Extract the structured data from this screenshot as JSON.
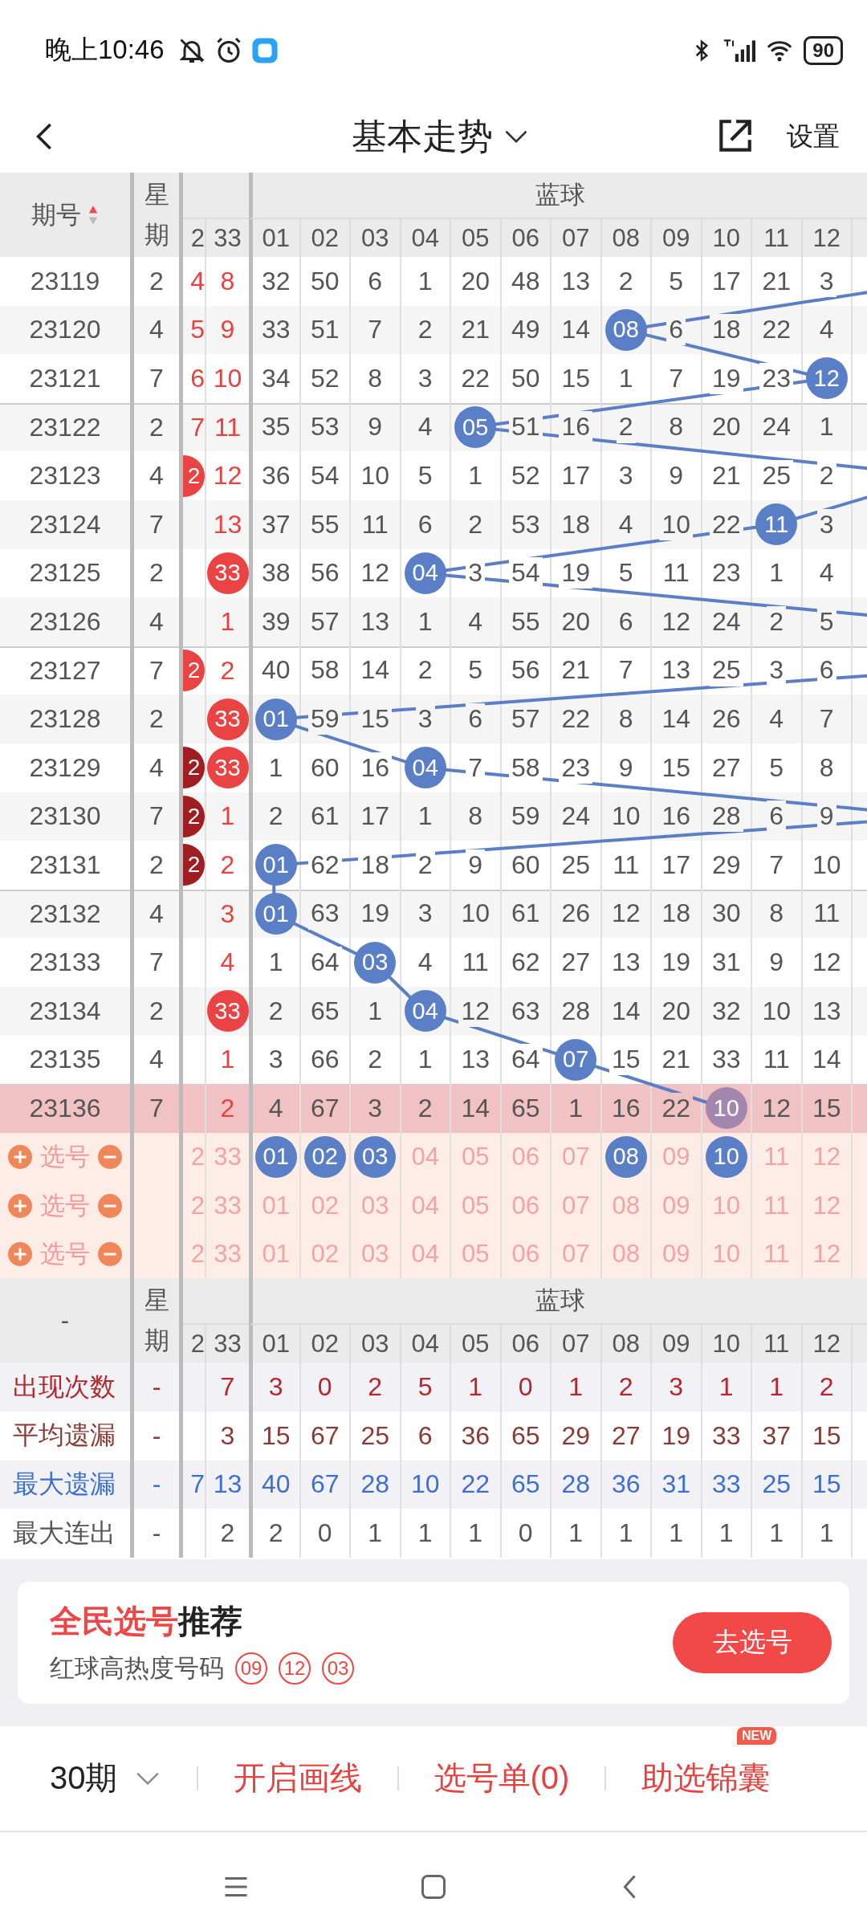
{
  "status_bar": {
    "time": "晚上10:46",
    "battery": "90"
  },
  "header": {
    "title": "基本走势",
    "settings": "设置"
  },
  "table_header": {
    "issue": "期号",
    "weekday": "星期",
    "group": "蓝球",
    "cut_column": "2",
    "red_column": "33",
    "columns": [
      "01",
      "02",
      "03",
      "04",
      "05",
      "06",
      "07",
      "08",
      "09",
      "10",
      "11",
      "12"
    ]
  },
  "rows": [
    {
      "issue": "23119",
      "weekday": "2",
      "cut": {
        "text": "4",
        "kind": "plain"
      },
      "red": {
        "text": "8",
        "ball": false
      },
      "blue": [
        {
          "text": "32",
          "ball": false
        },
        {
          "text": "50",
          "ball": false
        },
        {
          "text": "6",
          "ball": false
        },
        {
          "text": "1",
          "ball": false
        },
        {
          "text": "20",
          "ball": false
        },
        {
          "text": "48",
          "ball": false
        },
        {
          "text": "13",
          "ball": false
        },
        {
          "text": "2",
          "ball": false
        },
        {
          "text": "5",
          "ball": false
        },
        {
          "text": "17",
          "ball": false
        },
        {
          "text": "21",
          "ball": false
        },
        {
          "text": "3",
          "ball": false
        }
      ],
      "highlighted": false
    },
    {
      "issue": "23120",
      "weekday": "4",
      "cut": {
        "text": "5",
        "kind": "plain"
      },
      "red": {
        "text": "9",
        "ball": false
      },
      "blue": [
        {
          "text": "33",
          "ball": false
        },
        {
          "text": "51",
          "ball": false
        },
        {
          "text": "7",
          "ball": false
        },
        {
          "text": "2",
          "ball": false
        },
        {
          "text": "21",
          "ball": false
        },
        {
          "text": "49",
          "ball": false
        },
        {
          "text": "14",
          "ball": false
        },
        {
          "text": "08",
          "ball": true
        },
        {
          "text": "6",
          "ball": false
        },
        {
          "text": "18",
          "ball": false
        },
        {
          "text": "22",
          "ball": false
        },
        {
          "text": "4",
          "ball": false
        }
      ],
      "highlighted": false
    },
    {
      "issue": "23121",
      "weekday": "7",
      "cut": {
        "text": "6",
        "kind": "plain"
      },
      "red": {
        "text": "10",
        "ball": false
      },
      "blue": [
        {
          "text": "34",
          "ball": false
        },
        {
          "text": "52",
          "ball": false
        },
        {
          "text": "8",
          "ball": false
        },
        {
          "text": "3",
          "ball": false
        },
        {
          "text": "22",
          "ball": false
        },
        {
          "text": "50",
          "ball": false
        },
        {
          "text": "15",
          "ball": false
        },
        {
          "text": "1",
          "ball": false
        },
        {
          "text": "7",
          "ball": false
        },
        {
          "text": "19",
          "ball": false
        },
        {
          "text": "23",
          "ball": false
        },
        {
          "text": "12",
          "ball": true
        }
      ],
      "highlighted": false
    },
    {
      "issue": "23122",
      "weekday": "2",
      "cut": {
        "text": "7",
        "kind": "plain"
      },
      "red": {
        "text": "11",
        "ball": false
      },
      "blue": [
        {
          "text": "35",
          "ball": false
        },
        {
          "text": "53",
          "ball": false
        },
        {
          "text": "9",
          "ball": false
        },
        {
          "text": "4",
          "ball": false
        },
        {
          "text": "05",
          "ball": true
        },
        {
          "text": "51",
          "ball": false
        },
        {
          "text": "16",
          "ball": false
        },
        {
          "text": "2",
          "ball": false
        },
        {
          "text": "8",
          "ball": false
        },
        {
          "text": "20",
          "ball": false
        },
        {
          "text": "24",
          "ball": false
        },
        {
          "text": "1",
          "ball": false
        }
      ],
      "highlighted": false
    },
    {
      "issue": "23123",
      "weekday": "4",
      "cut": {
        "text": "2",
        "kind": "ball"
      },
      "red": {
        "text": "12",
        "ball": false
      },
      "blue": [
        {
          "text": "36",
          "ball": false
        },
        {
          "text": "54",
          "ball": false
        },
        {
          "text": "10",
          "ball": false
        },
        {
          "text": "5",
          "ball": false
        },
        {
          "text": "1",
          "ball": false
        },
        {
          "text": "52",
          "ball": false
        },
        {
          "text": "17",
          "ball": false
        },
        {
          "text": "3",
          "ball": false
        },
        {
          "text": "9",
          "ball": false
        },
        {
          "text": "21",
          "ball": false
        },
        {
          "text": "25",
          "ball": false
        },
        {
          "text": "2",
          "ball": false
        }
      ],
      "highlighted": false
    },
    {
      "issue": "23124",
      "weekday": "7",
      "red": {
        "text": "13",
        "ball": false
      },
      "blue": [
        {
          "text": "37",
          "ball": false
        },
        {
          "text": "55",
          "ball": false
        },
        {
          "text": "11",
          "ball": false
        },
        {
          "text": "6",
          "ball": false
        },
        {
          "text": "2",
          "ball": false
        },
        {
          "text": "53",
          "ball": false
        },
        {
          "text": "18",
          "ball": false
        },
        {
          "text": "4",
          "ball": false
        },
        {
          "text": "10",
          "ball": false
        },
        {
          "text": "22",
          "ball": false
        },
        {
          "text": "11",
          "ball": true
        },
        {
          "text": "3",
          "ball": false
        }
      ],
      "highlighted": false
    },
    {
      "issue": "23125",
      "weekday": "2",
      "red": {
        "text": "33",
        "ball": true
      },
      "blue": [
        {
          "text": "38",
          "ball": false
        },
        {
          "text": "56",
          "ball": false
        },
        {
          "text": "12",
          "ball": false
        },
        {
          "text": "04",
          "ball": true
        },
        {
          "text": "3",
          "ball": false
        },
        {
          "text": "54",
          "ball": false
        },
        {
          "text": "19",
          "ball": false
        },
        {
          "text": "5",
          "ball": false
        },
        {
          "text": "11",
          "ball": false
        },
        {
          "text": "23",
          "ball": false
        },
        {
          "text": "1",
          "ball": false
        },
        {
          "text": "4",
          "ball": false
        }
      ],
      "highlighted": false
    },
    {
      "issue": "23126",
      "weekday": "4",
      "red": {
        "text": "1",
        "ball": false
      },
      "blue": [
        {
          "text": "39",
          "ball": false
        },
        {
          "text": "57",
          "ball": false
        },
        {
          "text": "13",
          "ball": false
        },
        {
          "text": "1",
          "ball": false
        },
        {
          "text": "4",
          "ball": false
        },
        {
          "text": "55",
          "ball": false
        },
        {
          "text": "20",
          "ball": false
        },
        {
          "text": "6",
          "ball": false
        },
        {
          "text": "12",
          "ball": false
        },
        {
          "text": "24",
          "ball": false
        },
        {
          "text": "2",
          "ball": false
        },
        {
          "text": "5",
          "ball": false
        }
      ],
      "highlighted": false
    },
    {
      "issue": "23127",
      "weekday": "7",
      "cut": {
        "text": "2",
        "kind": "ball"
      },
      "red": {
        "text": "2",
        "ball": false
      },
      "blue": [
        {
          "text": "40",
          "ball": false
        },
        {
          "text": "58",
          "ball": false
        },
        {
          "text": "14",
          "ball": false
        },
        {
          "text": "2",
          "ball": false
        },
        {
          "text": "5",
          "ball": false
        },
        {
          "text": "56",
          "ball": false
        },
        {
          "text": "21",
          "ball": false
        },
        {
          "text": "7",
          "ball": false
        },
        {
          "text": "13",
          "ball": false
        },
        {
          "text": "25",
          "ball": false
        },
        {
          "text": "3",
          "ball": false
        },
        {
          "text": "6",
          "ball": false
        }
      ],
      "highlighted": false
    },
    {
      "issue": "23128",
      "weekday": "2",
      "red": {
        "text": "33",
        "ball": true
      },
      "blue": [
        {
          "text": "01",
          "ball": true
        },
        {
          "text": "59",
          "ball": false
        },
        {
          "text": "15",
          "ball": false
        },
        {
          "text": "3",
          "ball": false
        },
        {
          "text": "6",
          "ball": false
        },
        {
          "text": "57",
          "ball": false
        },
        {
          "text": "22",
          "ball": false
        },
        {
          "text": "8",
          "ball": false
        },
        {
          "text": "14",
          "ball": false
        },
        {
          "text": "26",
          "ball": false
        },
        {
          "text": "4",
          "ball": false
        },
        {
          "text": "7",
          "ball": false
        }
      ],
      "highlighted": false
    },
    {
      "issue": "23129",
      "weekday": "4",
      "cut": {
        "text": "2",
        "kind": "dark_ball"
      },
      "red": {
        "text": "33",
        "ball": true
      },
      "blue": [
        {
          "text": "1",
          "ball": false
        },
        {
          "text": "60",
          "ball": false
        },
        {
          "text": "16",
          "ball": false
        },
        {
          "text": "04",
          "ball": true
        },
        {
          "text": "7",
          "ball": false
        },
        {
          "text": "58",
          "ball": false
        },
        {
          "text": "23",
          "ball": false
        },
        {
          "text": "9",
          "ball": false
        },
        {
          "text": "15",
          "ball": false
        },
        {
          "text": "27",
          "ball": false
        },
        {
          "text": "5",
          "ball": false
        },
        {
          "text": "8",
          "ball": false
        }
      ],
      "highlighted": false
    },
    {
      "issue": "23130",
      "weekday": "7",
      "cut": {
        "text": "2",
        "kind": "dark_ball"
      },
      "red": {
        "text": "1",
        "ball": false
      },
      "blue": [
        {
          "text": "2",
          "ball": false
        },
        {
          "text": "61",
          "ball": false
        },
        {
          "text": "17",
          "ball": false
        },
        {
          "text": "1",
          "ball": false
        },
        {
          "text": "8",
          "ball": false
        },
        {
          "text": "59",
          "ball": false
        },
        {
          "text": "24",
          "ball": false
        },
        {
          "text": "10",
          "ball": false
        },
        {
          "text": "16",
          "ball": false
        },
        {
          "text": "28",
          "ball": false
        },
        {
          "text": "6",
          "ball": false
        },
        {
          "text": "9",
          "ball": false
        }
      ],
      "highlighted": false
    },
    {
      "issue": "23131",
      "weekday": "2",
      "cut": {
        "text": "2",
        "kind": "dark_ball"
      },
      "red": {
        "text": "2",
        "ball": false
      },
      "blue": [
        {
          "text": "01",
          "ball": true
        },
        {
          "text": "62",
          "ball": false
        },
        {
          "text": "18",
          "ball": false
        },
        {
          "text": "2",
          "ball": false
        },
        {
          "text": "9",
          "ball": false
        },
        {
          "text": "60",
          "ball": false
        },
        {
          "text": "25",
          "ball": false
        },
        {
          "text": "11",
          "ball": false
        },
        {
          "text": "17",
          "ball": false
        },
        {
          "text": "29",
          "ball": false
        },
        {
          "text": "7",
          "ball": false
        },
        {
          "text": "10",
          "ball": false
        }
      ],
      "highlighted": false
    },
    {
      "issue": "23132",
      "weekday": "4",
      "red": {
        "text": "3",
        "ball": false
      },
      "blue": [
        {
          "text": "01",
          "ball": true
        },
        {
          "text": "63",
          "ball": false
        },
        {
          "text": "19",
          "ball": false
        },
        {
          "text": "3",
          "ball": false
        },
        {
          "text": "10",
          "ball": false
        },
        {
          "text": "61",
          "ball": false
        },
        {
          "text": "26",
          "ball": false
        },
        {
          "text": "12",
          "ball": false
        },
        {
          "text": "18",
          "ball": false
        },
        {
          "text": "30",
          "ball": false
        },
        {
          "text": "8",
          "ball": false
        },
        {
          "text": "11",
          "ball": false
        }
      ],
      "highlighted": false
    },
    {
      "issue": "23133",
      "weekday": "7",
      "red": {
        "text": "4",
        "ball": false
      },
      "blue": [
        {
          "text": "1",
          "ball": false
        },
        {
          "text": "64",
          "ball": false
        },
        {
          "text": "03",
          "ball": true
        },
        {
          "text": "4",
          "ball": false
        },
        {
          "text": "11",
          "ball": false
        },
        {
          "text": "62",
          "ball": false
        },
        {
          "text": "27",
          "ball": false
        },
        {
          "text": "13",
          "ball": false
        },
        {
          "text": "19",
          "ball": false
        },
        {
          "text": "31",
          "ball": false
        },
        {
          "text": "9",
          "ball": false
        },
        {
          "text": "12",
          "ball": false
        }
      ],
      "highlighted": false
    },
    {
      "issue": "23134",
      "weekday": "2",
      "red": {
        "text": "33",
        "ball": true
      },
      "blue": [
        {
          "text": "2",
          "ball": false
        },
        {
          "text": "65",
          "ball": false
        },
        {
          "text": "1",
          "ball": false
        },
        {
          "text": "04",
          "ball": true
        },
        {
          "text": "12",
          "ball": false
        },
        {
          "text": "63",
          "ball": false
        },
        {
          "text": "28",
          "ball": false
        },
        {
          "text": "14",
          "ball": false
        },
        {
          "text": "20",
          "ball": false
        },
        {
          "text": "32",
          "ball": false
        },
        {
          "text": "10",
          "ball": false
        },
        {
          "text": "13",
          "ball": false
        }
      ],
      "highlighted": false
    },
    {
      "issue": "23135",
      "weekday": "4",
      "red": {
        "text": "1",
        "ball": false
      },
      "blue": [
        {
          "text": "3",
          "ball": false
        },
        {
          "text": "66",
          "ball": false
        },
        {
          "text": "2",
          "ball": false
        },
        {
          "text": "1",
          "ball": false
        },
        {
          "text": "13",
          "ball": false
        },
        {
          "text": "64",
          "ball": false
        },
        {
          "text": "07",
          "ball": true
        },
        {
          "text": "15",
          "ball": false
        },
        {
          "text": "21",
          "ball": false
        },
        {
          "text": "33",
          "ball": false
        },
        {
          "text": "11",
          "ball": false
        },
        {
          "text": "14",
          "ball": false
        }
      ],
      "highlighted": false
    },
    {
      "issue": "23136",
      "weekday": "7",
      "red": {
        "text": "2",
        "ball": false
      },
      "blue": [
        {
          "text": "4",
          "ball": false
        },
        {
          "text": "67",
          "ball": false
        },
        {
          "text": "3",
          "ball": false
        },
        {
          "text": "2",
          "ball": false
        },
        {
          "text": "14",
          "ball": false
        },
        {
          "text": "65",
          "ball": false
        },
        {
          "text": "1",
          "ball": false
        },
        {
          "text": "16",
          "ball": false
        },
        {
          "text": "22",
          "ball": false
        },
        {
          "text": "10",
          "ball": true
        },
        {
          "text": "12",
          "ball": false
        },
        {
          "text": "15",
          "ball": false
        }
      ],
      "highlighted": true
    }
  ],
  "pick_rows": [
    {
      "label": "选号",
      "cut": "2",
      "red": "33",
      "blue": [
        {
          "text": "01",
          "selected": true
        },
        {
          "text": "02",
          "selected": true
        },
        {
          "text": "03",
          "selected": true
        },
        {
          "text": "04",
          "selected": false
        },
        {
          "text": "05",
          "selected": false
        },
        {
          "text": "06",
          "selected": false
        },
        {
          "text": "07",
          "selected": false
        },
        {
          "text": "08",
          "selected": true
        },
        {
          "text": "09",
          "selected": false
        },
        {
          "text": "10",
          "selected": true
        },
        {
          "text": "11",
          "selected": false
        },
        {
          "text": "12",
          "selected": false
        }
      ]
    },
    {
      "label": "选号",
      "cut": "2",
      "red": "33",
      "blue": [
        {
          "text": "01",
          "selected": false
        },
        {
          "text": "02",
          "selected": false
        },
        {
          "text": "03",
          "selected": false
        },
        {
          "text": "04",
          "selected": false
        },
        {
          "text": "05",
          "selected": false
        },
        {
          "text": "06",
          "selected": false
        },
        {
          "text": "07",
          "selected": false
        },
        {
          "text": "08",
          "selected": false
        },
        {
          "text": "09",
          "selected": false
        },
        {
          "text": "10",
          "selected": false
        },
        {
          "text": "11",
          "selected": false
        },
        {
          "text": "12",
          "selected": false
        }
      ]
    },
    {
      "label": "选号",
      "cut": "2",
      "red": "33",
      "blue": [
        {
          "text": "01",
          "selected": false
        },
        {
          "text": "02",
          "selected": false
        },
        {
          "text": "03",
          "selected": false
        },
        {
          "text": "04",
          "selected": false
        },
        {
          "text": "05",
          "selected": false
        },
        {
          "text": "06",
          "selected": false
        },
        {
          "text": "07",
          "selected": false
        },
        {
          "text": "08",
          "selected": false
        },
        {
          "text": "09",
          "selected": false
        },
        {
          "text": "10",
          "selected": false
        },
        {
          "text": "11",
          "selected": false
        },
        {
          "text": "12",
          "selected": false
        }
      ]
    }
  ],
  "stats_header": {
    "corner": "-",
    "weekday": "星期",
    "group": "蓝球",
    "cut_column": "2",
    "red_column": "33",
    "columns": [
      "01",
      "02",
      "03",
      "04",
      "05",
      "06",
      "07",
      "08",
      "09",
      "10",
      "11",
      "12"
    ]
  },
  "stats": [
    {
      "label": "出现次数",
      "kind": "count",
      "weekday": "-",
      "red": "7",
      "values": [
        "3",
        "0",
        "2",
        "5",
        "1",
        "0",
        "1",
        "2",
        "3",
        "1",
        "1",
        "2"
      ]
    },
    {
      "label": "平均遗漏",
      "kind": "average",
      "weekday": "-",
      "red": "3",
      "values": [
        "15",
        "67",
        "25",
        "6",
        "36",
        "65",
        "29",
        "27",
        "19",
        "33",
        "37",
        "15"
      ]
    },
    {
      "label": "最大遗漏",
      "kind": "max",
      "weekday": "-",
      "cut": "7",
      "red": "13",
      "values": [
        "40",
        "67",
        "28",
        "10",
        "22",
        "65",
        "28",
        "36",
        "31",
        "33",
        "25",
        "15"
      ]
    },
    {
      "label": "最大连出",
      "kind": "streak",
      "weekday": "-",
      "red": "2",
      "values": [
        "2",
        "0",
        "1",
        "1",
        "1",
        "0",
        "1",
        "1",
        "1",
        "1",
        "1",
        "1"
      ]
    }
  ],
  "promo": {
    "highlight": "全民选号",
    "title": "推荐",
    "subtitle": "红球高热度号码",
    "numbers": [
      "09",
      "12",
      "03"
    ],
    "button": "去选号"
  },
  "toolbar": {
    "period": "30期",
    "draw": "开启画线",
    "list": "选号单(0)",
    "tips": "助选锦囊",
    "badge": "NEW"
  }
}
